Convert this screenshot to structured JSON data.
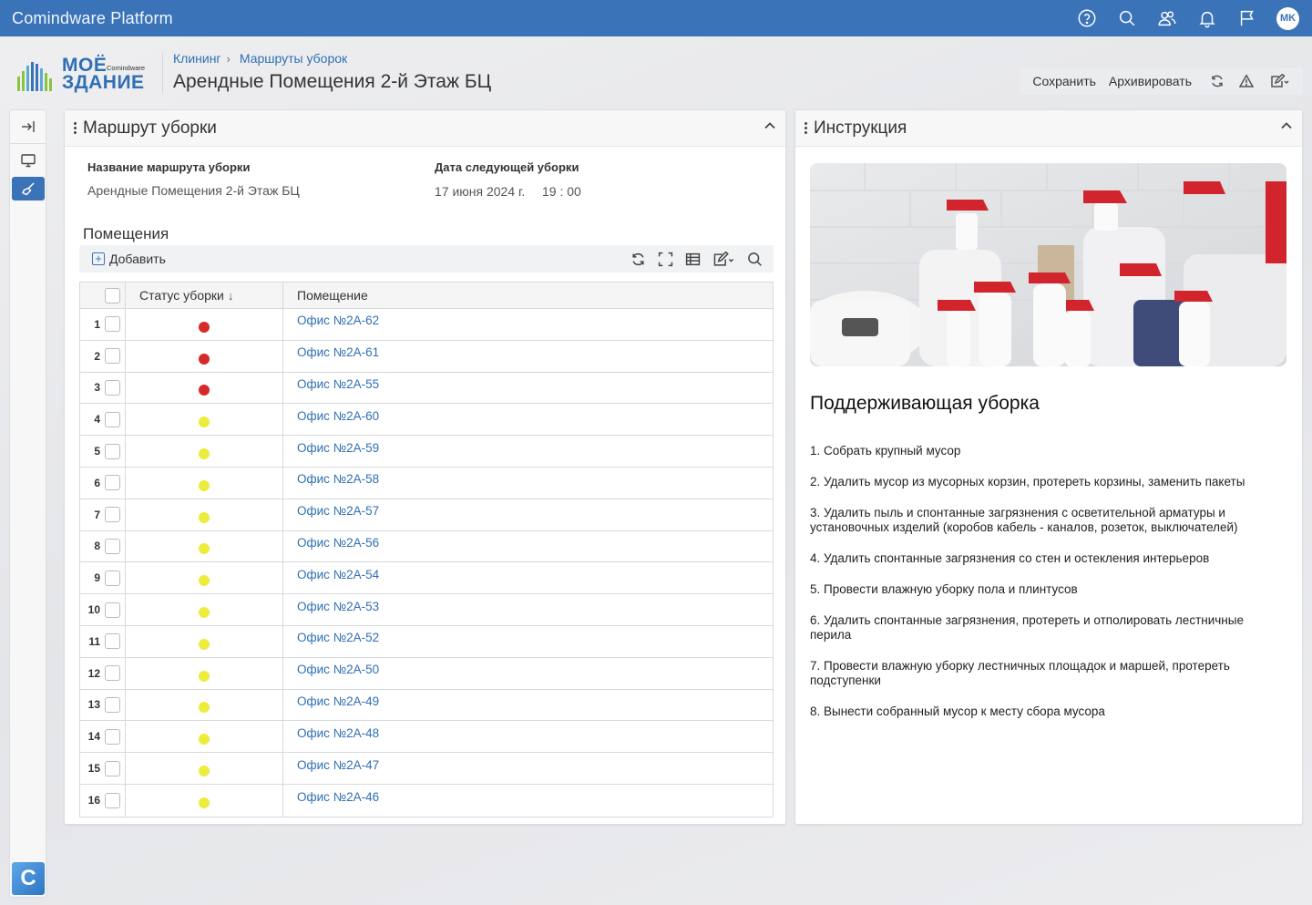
{
  "app": {
    "title": "Comindware Platform",
    "user_initials": "MK"
  },
  "logo": {
    "line1": "МОЁ",
    "line2": "ЗДАНИЕ",
    "vendor": "Comindware"
  },
  "breadcrumbs": [
    "Клининг",
    "Маршруты уборок"
  ],
  "page_title": "Арендные Помещения 2-й Этаж БЦ",
  "actions": {
    "save": "Сохранить",
    "archive": "Архивировать"
  },
  "route_panel": {
    "title": "Маршрут уборки",
    "name_label": "Название маршрута уборки",
    "name_value": "Арендные Помещения 2-й Этаж БЦ",
    "date_label": "Дата следующей уборки",
    "date_value": "17 июня 2024 г.",
    "time_value": "19 : 00",
    "section": "Помещения",
    "add_label": "Добавить",
    "columns": {
      "status": "Статус уборки",
      "room": "Помещение"
    },
    "colors": {
      "red": "#d62a2a",
      "yellow": "#ecec3c"
    },
    "rows": [
      {
        "n": "1",
        "status": "red",
        "room": "Офис №2А-62"
      },
      {
        "n": "2",
        "status": "red",
        "room": "Офис №2А-61"
      },
      {
        "n": "3",
        "status": "red",
        "room": "Офис №2А-55"
      },
      {
        "n": "4",
        "status": "yellow",
        "room": "Офис №2А-60"
      },
      {
        "n": "5",
        "status": "yellow",
        "room": "Офис №2А-59"
      },
      {
        "n": "6",
        "status": "yellow",
        "room": "Офис №2А-58"
      },
      {
        "n": "7",
        "status": "yellow",
        "room": "Офис №2А-57"
      },
      {
        "n": "8",
        "status": "yellow",
        "room": "Офис №2А-56"
      },
      {
        "n": "9",
        "status": "yellow",
        "room": "Офис №2А-54"
      },
      {
        "n": "10",
        "status": "yellow",
        "room": "Офис №2А-53"
      },
      {
        "n": "11",
        "status": "yellow",
        "room": "Офис №2А-52"
      },
      {
        "n": "12",
        "status": "yellow",
        "room": "Офис №2А-50"
      },
      {
        "n": "13",
        "status": "yellow",
        "room": "Офис №2А-49"
      },
      {
        "n": "14",
        "status": "yellow",
        "room": "Офис №2А-48"
      },
      {
        "n": "15",
        "status": "yellow",
        "room": "Офис №2А-47"
      },
      {
        "n": "16",
        "status": "yellow",
        "room": "Офис №2А-46"
      }
    ]
  },
  "instruction_panel": {
    "title": "Инструкция",
    "heading": "Поддерживающая уборка",
    "steps": [
      "1. Собрать крупный мусор",
      "2. Удалить мусор из мусорных корзин, протереть корзины, заменить пакеты",
      "3. Удалить пыль и спонтанные загрязнения с осветительной арматуры и установочных изделий (коробов кабель - каналов, розеток, выключателей)",
      "4. Удалить спонтанные загрязнения со стен и остекления интерьеров",
      "5. Провести влажную уборку пола и плинтусов",
      "6. Удалить спонтанные загрязнения, протереть и отполировать лестничные перила",
      "7. Провести влажную уборку лестничных площадок и маршей, протереть подступенки",
      "8. Вынести собранный мусор к месту сбора мусора"
    ]
  }
}
